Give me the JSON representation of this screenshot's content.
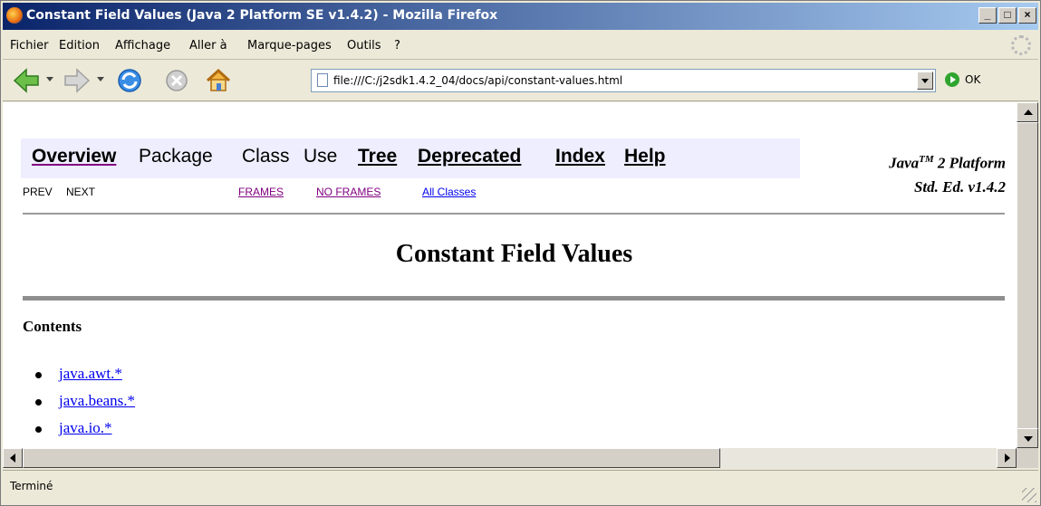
{
  "window": {
    "title": "Constant Field Values (Java 2 Platform SE v1.4.2) - Mozilla Firefox",
    "controls": {
      "minimize": "_",
      "maximize": "□",
      "close": "×"
    }
  },
  "menu": {
    "items": [
      "Fichier",
      "Edition",
      "Affichage",
      "Aller à",
      "Marque-pages",
      "Outils",
      "?"
    ]
  },
  "toolbar": {
    "url": "file:///C:/j2sdk1.4.2_04/docs/api/constant-values.html",
    "go_label": "OK",
    "icons": [
      "back-arrow-icon",
      "forward-arrow-icon",
      "reload-icon",
      "stop-icon",
      "home-icon",
      "page-icon",
      "go-icon"
    ]
  },
  "javadoc": {
    "nav": {
      "overview": "Overview",
      "package": "Package",
      "class": "Class",
      "use": "Use",
      "tree": "Tree",
      "deprecated": "Deprecated",
      "index": "Index",
      "help": "Help"
    },
    "platform_line1": "Java",
    "platform_tm": "TM",
    "platform_line1_rest": " 2 Platform",
    "platform_line2": "Std. Ed. v1.4.2",
    "subnav": {
      "prev": "PREV",
      "next": "NEXT",
      "frames": "FRAMES",
      "no_frames": "NO FRAMES",
      "all_classes": "All Classes"
    },
    "heading": "Constant Field Values",
    "contents_label": "Contents",
    "packages": [
      "java.awt.*",
      "java.beans.*",
      "java.io.*"
    ]
  },
  "status": {
    "text": "Terminé"
  },
  "colors": {
    "nav_bg": "#eeeeff",
    "link": "#0000ee",
    "visited": "#800080",
    "title_bar": "#0a246a"
  }
}
